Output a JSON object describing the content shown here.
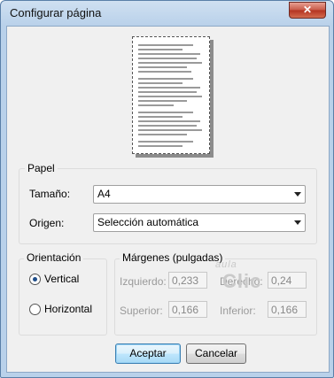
{
  "window": {
    "title": "Configurar página"
  },
  "paper": {
    "legend": "Papel",
    "size_label": "Tamaño:",
    "size_value": "A4",
    "source_label": "Origen:",
    "source_value": "Selección automática"
  },
  "orientation": {
    "legend": "Orientación",
    "options": [
      "Vertical",
      "Horizontal"
    ],
    "selected": "Vertical"
  },
  "margins": {
    "legend": "Márgenes (pulgadas)",
    "left_label": "Izquierdo:",
    "left_value": "0,233",
    "right_label": "Derecho:",
    "right_value": "0,24",
    "top_label": "Superior:",
    "top_value": "0,166",
    "bottom_label": "Inferior:",
    "bottom_value": "0,166"
  },
  "buttons": {
    "ok": "Aceptar",
    "cancel": "Cancelar"
  },
  "watermark": {
    "small": "aula",
    "big": "Clic"
  },
  "icons": {
    "close": "close-icon",
    "dropdown": "chevron-down-icon"
  }
}
